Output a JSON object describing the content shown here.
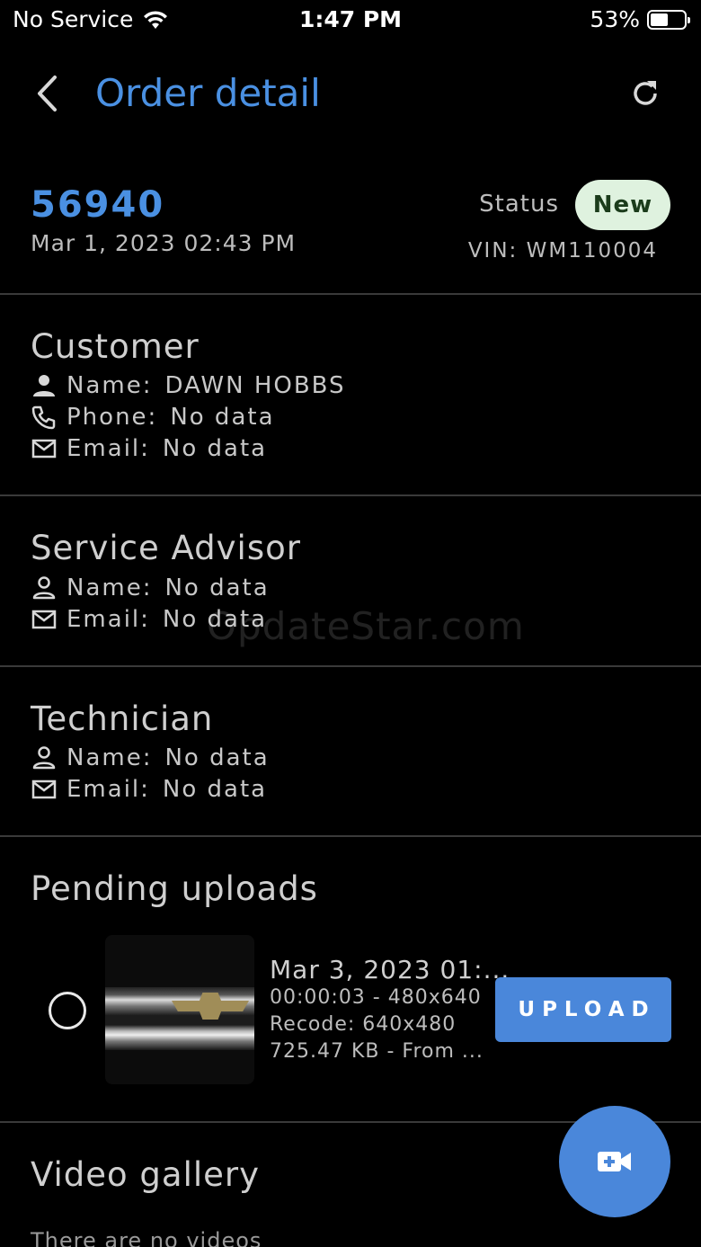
{
  "status_bar": {
    "carrier": "No Service",
    "time": "1:47 PM",
    "battery_pct": "53%",
    "battery_level": 0.53
  },
  "app_bar": {
    "title": "Order detail",
    "back_icon": "chevron-left-icon",
    "refresh_icon": "refresh-icon"
  },
  "order": {
    "number": "56940",
    "date": "Mar 1, 2023 02:43 PM",
    "status_label": "Status",
    "status": "New",
    "vin_label": "VIN:",
    "vin": "WM110004"
  },
  "customer": {
    "title": "Customer",
    "name_label": "Name:",
    "name": "DAWN HOBBS",
    "phone_label": "Phone:",
    "phone": "No data",
    "email_label": "Email:",
    "email": "No data"
  },
  "service_advisor": {
    "title": "Service Advisor",
    "name_label": "Name:",
    "name": "No data",
    "email_label": "Email:",
    "email": "No data"
  },
  "technician": {
    "title": "Technician",
    "name_label": "Name:",
    "name": "No data",
    "email_label": "Email:",
    "email": "No data"
  },
  "watermark": "OpdateStar.com",
  "pending_uploads": {
    "title": "Pending uploads",
    "items": [
      {
        "title": "Mar 3, 2023 01:...",
        "line1": "00:00:03 - 480x640",
        "line2": "Recode: 640x480",
        "line3": "725.47 KB  - From ...",
        "button": "UPLOAD"
      }
    ]
  },
  "video_gallery": {
    "title": "Video gallery",
    "empty_text": "There are no videos"
  },
  "colors": {
    "accent": "#4a90e2",
    "button": "#4a87da",
    "badge_bg": "#dff2df",
    "background": "#000000"
  }
}
